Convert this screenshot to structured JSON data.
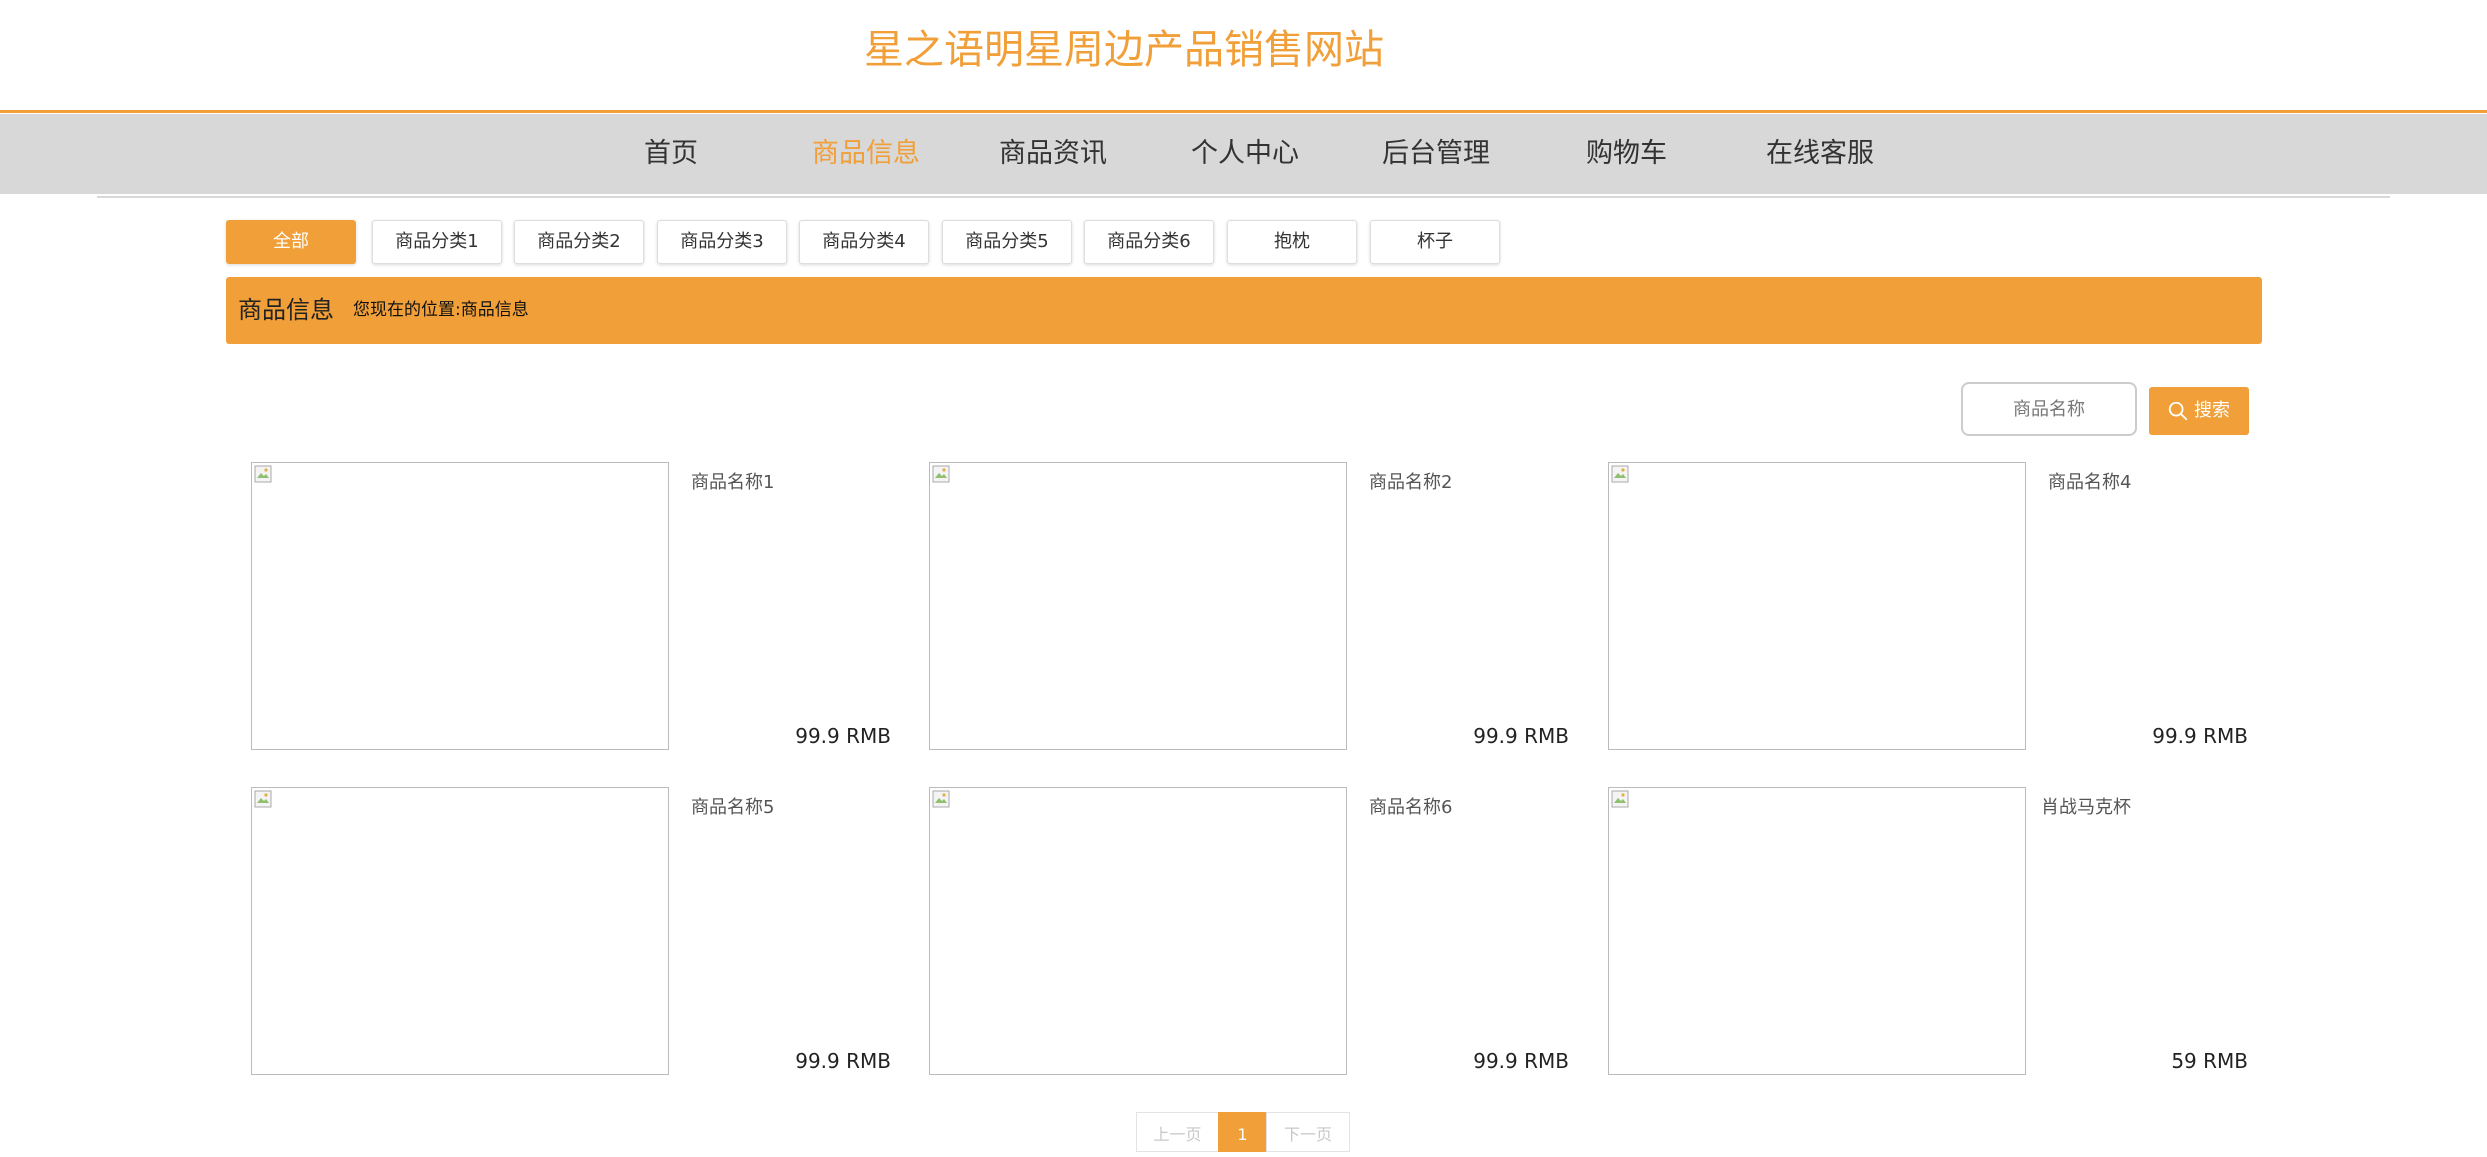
{
  "site": {
    "title": "星之语明星周边产品销售网站"
  },
  "nav": {
    "items": [
      "首页",
      "商品信息",
      "商品资讯",
      "个人中心",
      "后台管理",
      "购物车",
      "在线客服"
    ],
    "active": "商品信息"
  },
  "categories": {
    "items": [
      "全部",
      "商品分类1",
      "商品分类2",
      "商品分类3",
      "商品分类4",
      "商品分类5",
      "商品分类6",
      "抱枕",
      "杯子"
    ],
    "active": "全部"
  },
  "section": {
    "title": "商品信息",
    "breadcrumb_prefix": "您现在的位置:",
    "breadcrumb_current": "商品信息"
  },
  "search": {
    "placeholder": "商品名称",
    "button_label": "搜索"
  },
  "products": [
    {
      "name": "商品名称1",
      "price": "99.9 RMB"
    },
    {
      "name": "商品名称2",
      "price": "99.9 RMB"
    },
    {
      "name": "商品名称4",
      "price": "99.9 RMB"
    },
    {
      "name": "商品名称5",
      "price": "99.9 RMB"
    },
    {
      "name": "商品名称6",
      "price": "99.9 RMB"
    },
    {
      "name": "肖战马克杯",
      "price": "59 RMB"
    }
  ],
  "pagination": {
    "prev_label": "上一页",
    "current_page": "1",
    "next_label": "下一页"
  },
  "colors": {
    "accent": "#f19f38",
    "nav_background": "#d8d8d8",
    "text": "#333333"
  },
  "icons": {
    "search": "search-icon",
    "product_image": "broken-image-icon"
  }
}
